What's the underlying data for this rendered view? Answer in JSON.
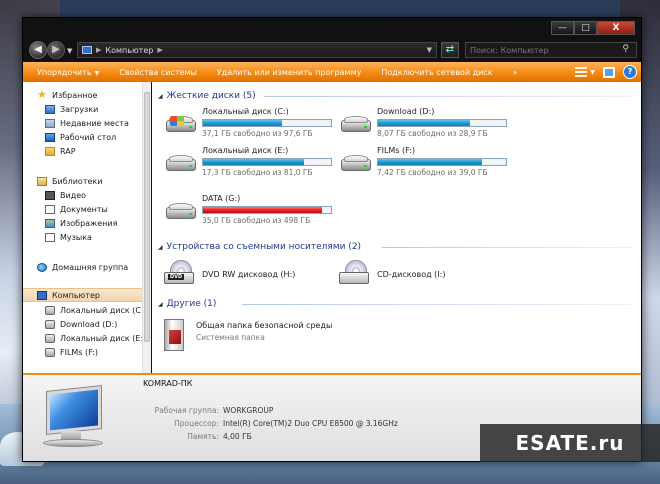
{
  "watermark": "ESATE.ru",
  "window": {
    "buttons": {
      "minimize": "—",
      "maximize": "□",
      "close": "X"
    }
  },
  "navbar": {
    "address": "Компьютер",
    "search_placeholder": "Поиск: Компьютер"
  },
  "toolbar": {
    "items": [
      "Упорядочить",
      "Свойства системы",
      "Удалить или изменить программу",
      "Подключить сетевой диск",
      "»"
    ]
  },
  "sidebar": {
    "favorites": "Избранное",
    "favorite_items": [
      "Загрузки",
      "Недавние места",
      "Рабочий стол",
      "RAP"
    ],
    "libraries": "Библиотеки",
    "library_items": [
      "Видео",
      "Документы",
      "Изображения",
      "Музыка"
    ],
    "homegroup": "Домашняя группа",
    "computer": "Компьютер",
    "drives": [
      "Локальный диск (C:)",
      "Download (D:)",
      "Локальный диск (E:)",
      "FILMs (F:)"
    ]
  },
  "content": {
    "hard_disks_header": "Жесткие диски (5)",
    "drives": [
      {
        "name": "Локальный диск (C:)",
        "free": "37,1 ГБ свободно из 97,6 ГБ",
        "used_fraction": 0.62,
        "status": "normal"
      },
      {
        "name": "Download (D:)",
        "free": "8,07 ГБ свободно из 28,9 ГБ",
        "used_fraction": 0.72,
        "status": "normal"
      },
      {
        "name": "Локальный диск (E:)",
        "free": "17,3 ГБ свободно из 81,0 ГБ",
        "used_fraction": 0.79,
        "status": "normal"
      },
      {
        "name": "FILMs (F:)",
        "free": "7,42 ГБ свободно из 39,0 ГБ",
        "used_fraction": 0.81,
        "status": "normal"
      },
      {
        "name": "DATA (G:)",
        "free": "35,0 ГБ свободно из 498 ГБ",
        "used_fraction": 0.93,
        "status": "low"
      }
    ],
    "removable_header": "Устройства со съемными носителями (2)",
    "removable": [
      "DVD RW дисковод (H:)",
      "CD-дисковод (I:)"
    ],
    "dvd_badge": "DVD",
    "other_header": "Другие (1)",
    "other_item_name": "Общая папка безопасной среды",
    "other_item_type": "Системная папка"
  },
  "details": {
    "computer_name": "KOMRAD-ПК",
    "rows": [
      {
        "key": "Рабочая группа:",
        "value": "WORKGROUP"
      },
      {
        "key": "Процессор:",
        "value": "Intel(R) Core(TM)2 Duo CPU     E8500  @ 3.16GHz"
      },
      {
        "key": "Память:",
        "value": "4,00 ГБ"
      }
    ]
  },
  "colors": {
    "toolbar_orange": "#f38a12",
    "bar_normal": "#1c96cc",
    "bar_low": "#e81d1d",
    "group_header": "#1e3a8c"
  }
}
